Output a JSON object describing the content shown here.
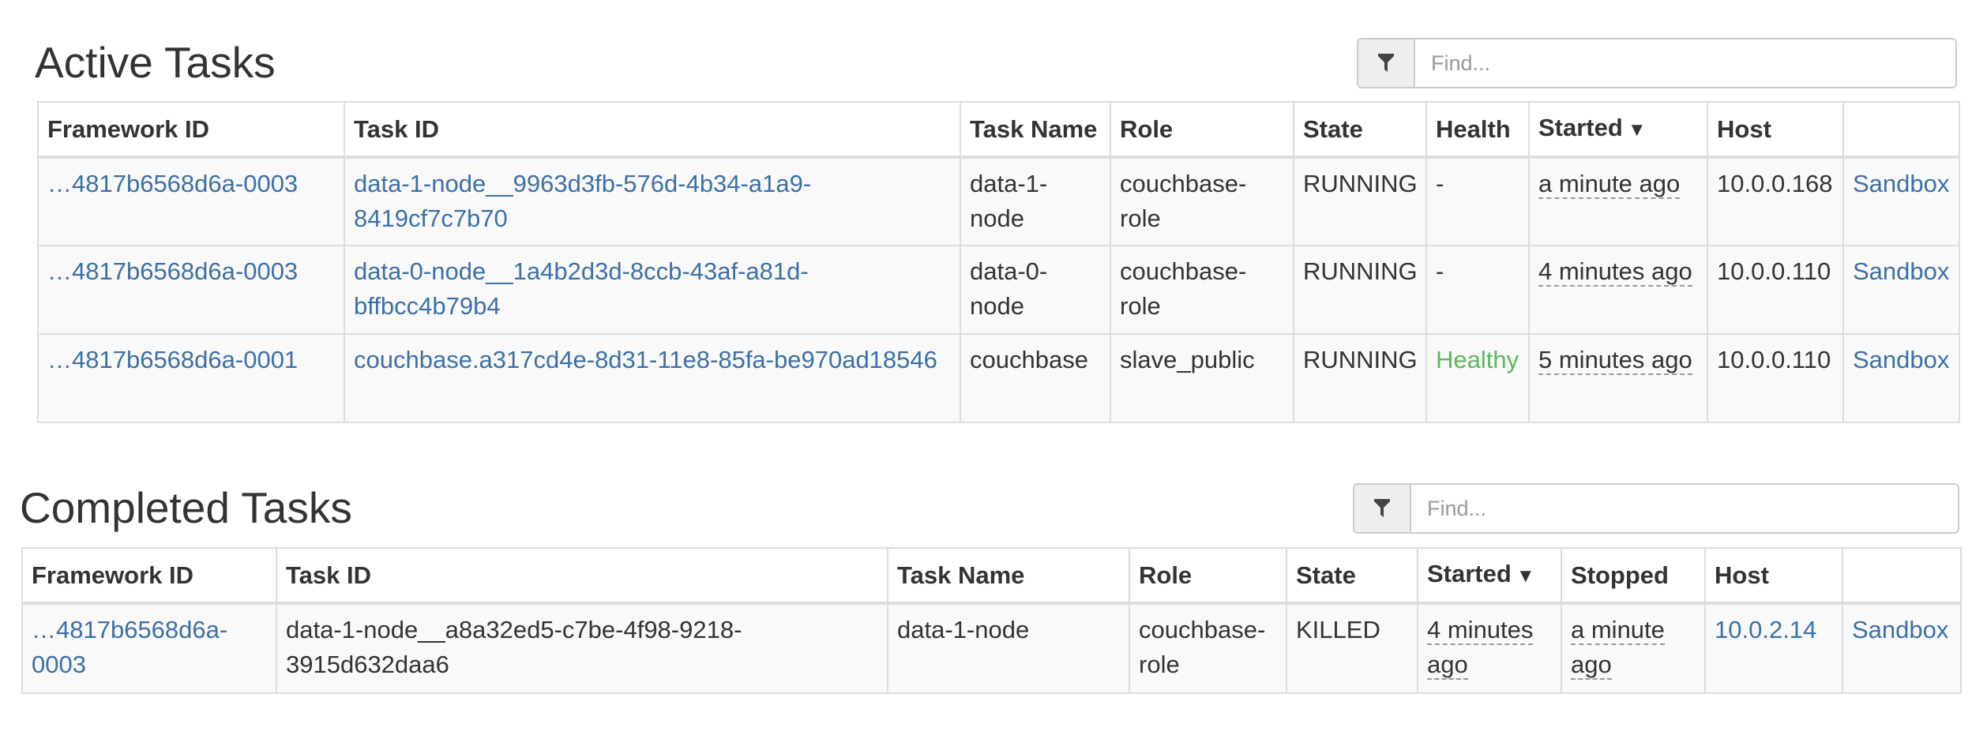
{
  "active": {
    "title": "Active Tasks",
    "search_placeholder": "Find...",
    "headers": [
      "Framework ID",
      "Task ID",
      "Task Name",
      "Role",
      "State",
      "Health",
      "Started",
      "Host",
      ""
    ],
    "sort_indicator": "▼",
    "rows": [
      {
        "framework_id": "…4817b6568d6a-0003",
        "task_id_l1": "data-1-node__9963d3fb-576d-4b34-a1a9-",
        "task_id_l2": "8419cf7c7b70",
        "task_name_l1": "data-1-",
        "task_name_l2": "node",
        "role_l1": "couchbase-",
        "role_l2": "role",
        "state": "RUNNING",
        "health": "-",
        "started": "a minute ago",
        "host": "10.0.0.168",
        "sandbox": "Sandbox"
      },
      {
        "framework_id": "…4817b6568d6a-0003",
        "task_id_l1": "data-0-node__1a4b2d3d-8ccb-43af-a81d-",
        "task_id_l2": "bffbcc4b79b4",
        "task_name_l1": "data-0-",
        "task_name_l2": "node",
        "role_l1": "couchbase-",
        "role_l2": "role",
        "state": "RUNNING",
        "health": "-",
        "started": "4 minutes ago",
        "host": "10.0.0.110",
        "sandbox": "Sandbox"
      },
      {
        "framework_id": "…4817b6568d6a-0001",
        "task_id_l1": "couchbase.a317cd4e-8d31-11e8-85fa-be970ad18546",
        "task_id_l2": "",
        "task_name_l1": "couchbase",
        "task_name_l2": "",
        "role_l1": "slave_public",
        "role_l2": "",
        "state": "RUNNING",
        "health": "Healthy",
        "started": "5 minutes ago",
        "host": "10.0.0.110",
        "sandbox": "Sandbox"
      }
    ]
  },
  "completed": {
    "title": "Completed Tasks",
    "search_placeholder": "Find...",
    "headers": [
      "Framework ID",
      "Task ID",
      "Task Name",
      "Role",
      "State",
      "Started",
      "Stopped",
      "Host",
      ""
    ],
    "sort_indicator": "▼",
    "rows": [
      {
        "framework_id_l1": "…4817b6568d6a-",
        "framework_id_l2": "0003",
        "task_id_l1": "data-1-node__a8a32ed5-c7be-4f98-9218-",
        "task_id_l2": "3915d632daa6",
        "task_name": "data-1-node",
        "role_l1": "couchbase-",
        "role_l2": "role",
        "state": "KILLED",
        "started_l1": "4 minutes",
        "started_l2": "ago",
        "stopped_l1": "a minute",
        "stopped_l2": "ago",
        "host": "10.0.2.14",
        "sandbox": "Sandbox"
      }
    ]
  },
  "colors": {
    "link": "#3c70a8",
    "healthy": "#5cb85c",
    "text": "#333333",
    "border": "#dddddd",
    "row_bg": "#f9f9f9"
  },
  "icons": {
    "filter": "filter-icon"
  }
}
